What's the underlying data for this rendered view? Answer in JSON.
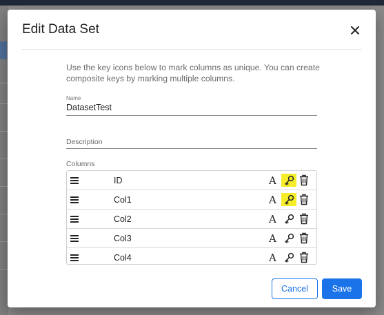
{
  "dialog": {
    "title": "Edit Data Set",
    "intro": "Use the key icons below to mark columns as unique. You can create composite keys by marking multiple columns."
  },
  "fields": {
    "name_label": "Name",
    "name_value": "DatasetTest",
    "description_label": "Description",
    "description_value": ""
  },
  "columns": {
    "label": "Columns",
    "type_glyph": "A",
    "rows": [
      {
        "name": "ID",
        "is_key": true
      },
      {
        "name": "Col1",
        "is_key": true
      },
      {
        "name": "Col2",
        "is_key": false
      },
      {
        "name": "Col3",
        "is_key": false
      },
      {
        "name": "Col4",
        "is_key": false
      }
    ]
  },
  "buttons": {
    "cancel": "Cancel",
    "save": "Save"
  },
  "colors": {
    "primary": "#1a73e8",
    "key_highlight": "#f5ec2a"
  },
  "icons": {
    "close": "close-icon",
    "drag": "drag-handle-icon",
    "type": "text-type-icon",
    "key": "key-icon",
    "delete": "trash-icon"
  }
}
